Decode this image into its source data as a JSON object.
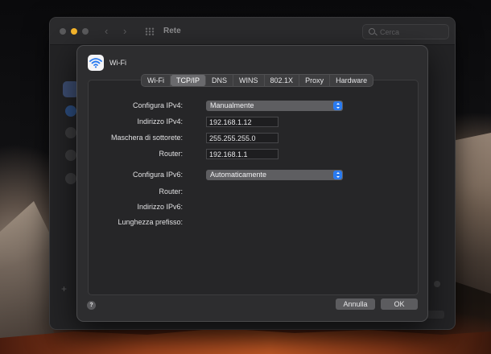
{
  "window": {
    "title": "Rete",
    "search_placeholder": "Cerca"
  },
  "sheet": {
    "title": "Wi-Fi",
    "tabs": [
      {
        "label": "Wi-Fi",
        "active": false
      },
      {
        "label": "TCP/IP",
        "active": true
      },
      {
        "label": "DNS",
        "active": false
      },
      {
        "label": "WINS",
        "active": false
      },
      {
        "label": "802.1X",
        "active": false
      },
      {
        "label": "Proxy",
        "active": false
      },
      {
        "label": "Hardware",
        "active": false
      }
    ],
    "ipv4": {
      "config_label": "Configura IPv4:",
      "config_value": "Manualmente",
      "address_label": "Indirizzo IPv4:",
      "address_value": "192.168.1.12",
      "subnet_label": "Maschera di sottorete:",
      "subnet_value": "255.255.255.0",
      "router_label": "Router:",
      "router_value": "192.168.1.1"
    },
    "ipv6": {
      "config_label": "Configura IPv6:",
      "config_value": "Automaticamente",
      "router_label": "Router:",
      "address_label": "Indirizzo IPv6:",
      "prefix_label": "Lunghezza prefisso:"
    },
    "help_label": "?",
    "cancel_label": "Annulla",
    "ok_label": "OK"
  },
  "colors": {
    "accent": "#2a7bf0",
    "traffic_minimize": "#f4b42b",
    "sheet_bg": "#2d2d2f"
  },
  "icons": [
    "wifi-icon",
    "search-icon",
    "grid-icon",
    "chevron-left-icon",
    "chevron-right-icon",
    "popup-arrows-icon",
    "help-icon"
  ]
}
